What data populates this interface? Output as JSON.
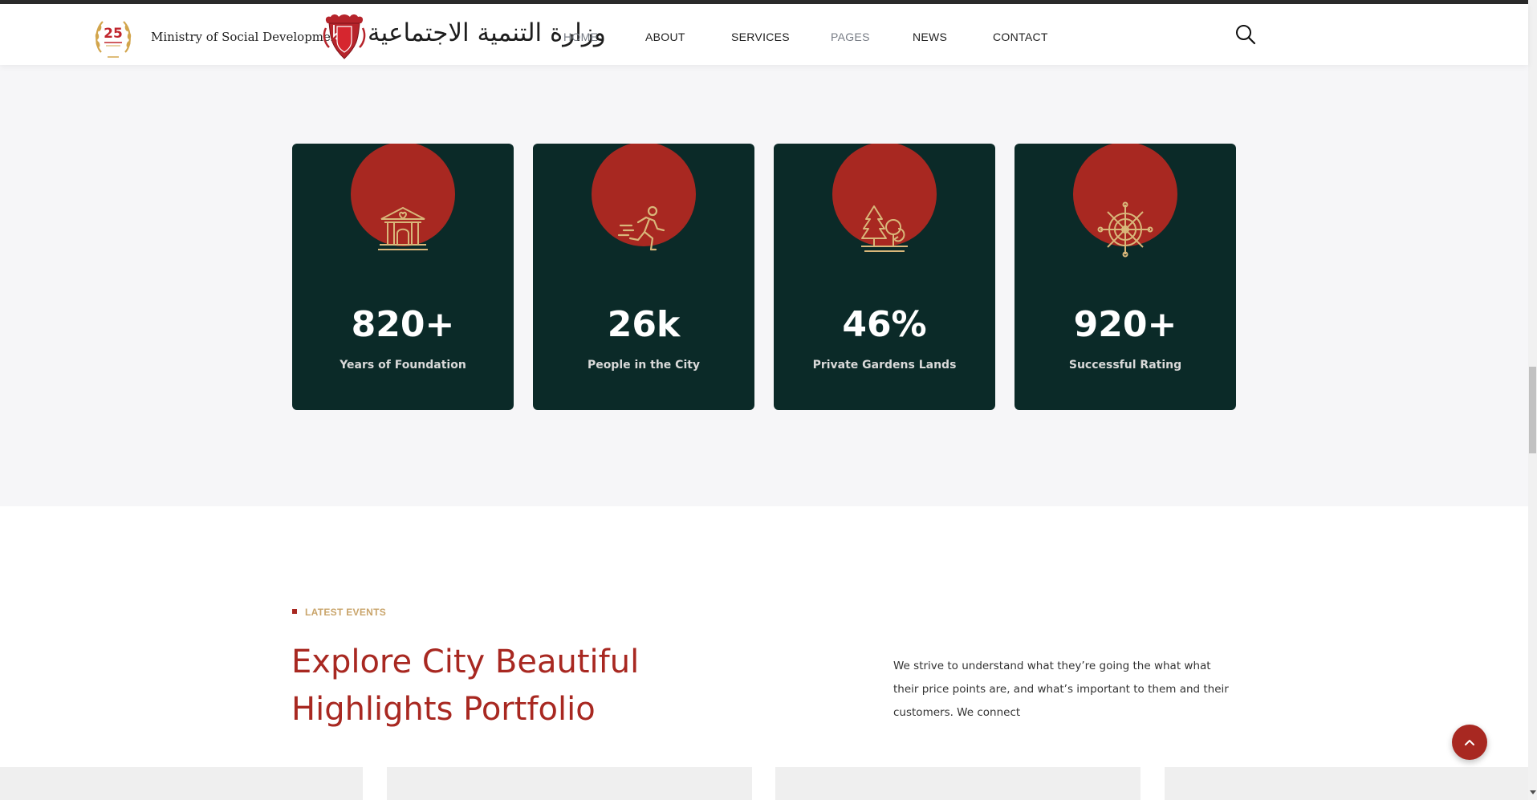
{
  "header": {
    "badge_number": "25",
    "ministry_name": "Ministry of Social Development",
    "arabic_name": "وزارة التنمية الاجتماعية",
    "nav": [
      {
        "label": "HOME",
        "state": "muted"
      },
      {
        "label": "ABOUT",
        "state": "normal"
      },
      {
        "label": "SERVICES",
        "state": "normal"
      },
      {
        "label": "PAGES",
        "state": "muted"
      },
      {
        "label": "NEWS",
        "state": "normal"
      },
      {
        "label": "CONTACT",
        "state": "normal"
      }
    ],
    "search_icon": "search-icon"
  },
  "stats": [
    {
      "value": "820+",
      "label": "Years of Foundation",
      "icon": "building-heart-icon"
    },
    {
      "value": "26k",
      "label": "People in the City",
      "icon": "running-person-icon"
    },
    {
      "value": "46%",
      "label": "Private Gardens Lands",
      "icon": "trees-garden-icon"
    },
    {
      "value": "920+",
      "label": "Successful Rating",
      "icon": "ship-wheel-icon"
    }
  ],
  "events": {
    "kicker": "LATEST EVENTS",
    "title": "Explore City Beautiful Highlights Portfolio",
    "description": "We strive to understand what they’re going the what what their price points are, and what’s important to them and their customers. We connect"
  },
  "colors": {
    "accent_red": "#a82821",
    "card_dark_green": "#0b2a28",
    "icon_gold": "#d9b77a",
    "kicker_gold": "#c9a46a",
    "section_bg": "#f6f6f8"
  },
  "scroll_top_icon": "chevron-up-icon"
}
